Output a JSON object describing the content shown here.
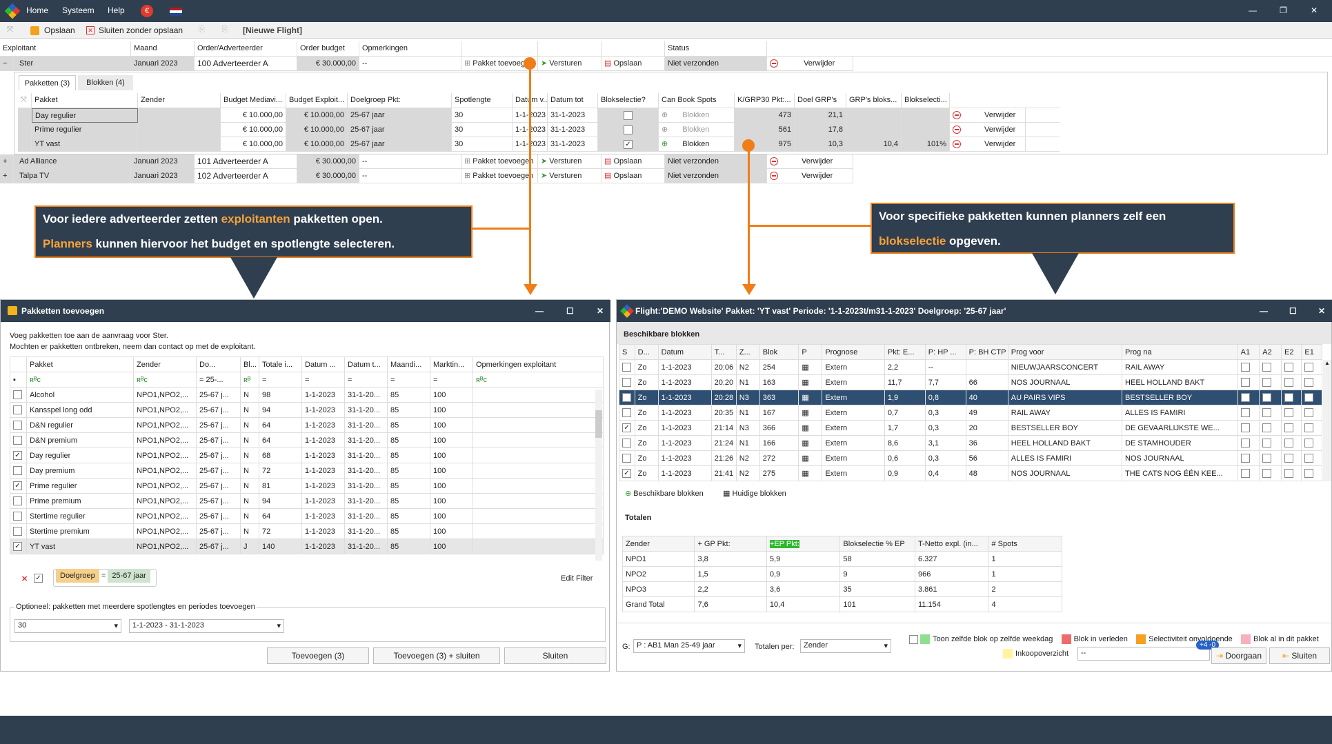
{
  "menu": {
    "home": "Home",
    "system": "Systeem",
    "help": "Help"
  },
  "toolbar": {
    "save": "Opslaan",
    "close_nosave": "Sluiten zonder opslaan",
    "new_flight": "[Nieuwe Flight]"
  },
  "orders": {
    "headers": [
      "Exploitant",
      "Maand",
      "Order/Adverteerder",
      "Order budget",
      "Opmerkingen",
      "",
      "",
      "",
      "Status"
    ],
    "rows": [
      {
        "exp": "Ster",
        "maand": "Januari 2023",
        "order": "100 Adverteerder A",
        "budget": "€ 30.000,00",
        "opm": "--",
        "add": "Pakket toevoegen",
        "send": "Versturen",
        "save": "Opslaan",
        "status": "Niet verzonden",
        "del": "Verwijder"
      },
      {
        "exp": "Ad Alliance",
        "maand": "Januari 2023",
        "order": "101 Adverteerder A",
        "budget": "€ 30.000,00",
        "opm": "--",
        "add": "Pakket toevoegen",
        "send": "Versturen",
        "save": "Opslaan",
        "status": "Niet verzonden",
        "del": "Verwijder"
      },
      {
        "exp": "Talpa TV",
        "maand": "Januari 2023",
        "order": "102 Adverteerder A",
        "budget": "€ 30.000,00",
        "opm": "--",
        "add": "Pakket toevoegen",
        "send": "Versturen",
        "save": "Opslaan",
        "status": "Niet verzonden",
        "del": "Verwijder"
      }
    ]
  },
  "subtabs": [
    "Pakketten (3)",
    "Blokken (4)"
  ],
  "pakketten": {
    "headers": [
      "Pakket",
      "Zender",
      "Budget Mediavi...",
      "Budget Exploit...",
      "Doelgroep Pkt:",
      "Spotlengte",
      "Datum v...",
      "Datum tot",
      "Blokselectie?",
      "Can Book Spots",
      "K/GRP30 Pkt:...",
      "Doel GRP's",
      "GRP's bloks...",
      "Blokselecti..."
    ],
    "rows": [
      [
        "Day regulier",
        "",
        "€ 10.000,00",
        "€ 10.000,00",
        "25-67 jaar",
        "30",
        "1-1-2023",
        "31-1-2023",
        "",
        "Blokken",
        "473",
        "21,1",
        "",
        ""
      ],
      [
        "Prime regulier",
        "",
        "€ 10.000,00",
        "€ 10.000,00",
        "25-67 jaar",
        "30",
        "1-1-2023",
        "31-1-2023",
        "",
        "Blokken",
        "561",
        "17,8",
        "",
        ""
      ],
      [
        "YT vast",
        "",
        "€ 10.000,00",
        "€ 10.000,00",
        "25-67 jaar",
        "30",
        "1-1-2023",
        "31-1-2023",
        "✓",
        "Blokken",
        "975",
        "10,3",
        "10,4",
        "101%"
      ]
    ],
    "del": "Verwijder"
  },
  "callout_left": {
    "l1a": "Voor iedere adverteerder zetten ",
    "l1b": "exploitanten",
    "l1c": " pakketten open.",
    "l2a": "Planners",
    "l2b": " kunnen hiervoor het budget en spotlengte selecteren."
  },
  "callout_right": {
    "l1": "Voor specifieke pakketten kunnen planners zelf een",
    "l2a": "blokselectie",
    "l2b": " opgeven."
  },
  "dlg1": {
    "title": "Pakketten toevoegen",
    "intro1": "Voeg pakketten toe aan de aanvraag voor Ster.",
    "intro2": "Mochten er pakketten ontbreken, neem dan contact op met de exploitant.",
    "headers": [
      "Pakket",
      "Zender",
      "Do...",
      "Bl...",
      "Totale i...",
      "Datum ...",
      "Datum t...",
      "Maandi...",
      "Marktin...",
      "Opmerkingen exploitant"
    ],
    "filter_do": "25-...",
    "rows": [
      [
        "",
        "Alcohol",
        "NPO1,NPO2,...",
        "25-67 j...",
        "N",
        "98",
        "1-1-2023",
        "31-1-20...",
        "85",
        "100"
      ],
      [
        "",
        "Kansspel long odd",
        "NPO1,NPO2,...",
        "25-67 j...",
        "N",
        "94",
        "1-1-2023",
        "31-1-20...",
        "85",
        "100"
      ],
      [
        "",
        "D&N regulier",
        "NPO1,NPO2,...",
        "25-67 j...",
        "N",
        "64",
        "1-1-2023",
        "31-1-20...",
        "85",
        "100"
      ],
      [
        "",
        "D&N premium",
        "NPO1,NPO2,...",
        "25-67 j...",
        "N",
        "64",
        "1-1-2023",
        "31-1-20...",
        "85",
        "100"
      ],
      [
        "✓",
        "Day regulier",
        "NPO1,NPO2,...",
        "25-67 j...",
        "N",
        "68",
        "1-1-2023",
        "31-1-20...",
        "85",
        "100"
      ],
      [
        "",
        "Day premium",
        "NPO1,NPO2,...",
        "25-67 j...",
        "N",
        "72",
        "1-1-2023",
        "31-1-20...",
        "85",
        "100"
      ],
      [
        "✓",
        "Prime regulier",
        "NPO1,NPO2,...",
        "25-67 j...",
        "N",
        "81",
        "1-1-2023",
        "31-1-20...",
        "85",
        "100"
      ],
      [
        "",
        "Prime premium",
        "NPO1,NPO2,...",
        "25-67 j...",
        "N",
        "94",
        "1-1-2023",
        "31-1-20...",
        "85",
        "100"
      ],
      [
        "",
        "Stertime regulier",
        "NPO1,NPO2,...",
        "25-67 j...",
        "N",
        "64",
        "1-1-2023",
        "31-1-20...",
        "85",
        "100"
      ],
      [
        "",
        "Stertime premium",
        "NPO1,NPO2,...",
        "25-67 j...",
        "N",
        "72",
        "1-1-2023",
        "31-1-20...",
        "85",
        "100"
      ],
      [
        "✓",
        "YT vast",
        "NPO1,NPO2,...",
        "25-67 j...",
        "J",
        "140",
        "1-1-2023",
        "31-1-20...",
        "85",
        "100"
      ]
    ],
    "filter_label": "Doelgroep",
    "filter_value": "25-67 jaar",
    "edit_filter": "Edit Filter",
    "optional": "Optioneel: pakketten met meerdere spotlengtes en periodes toevoegen",
    "spot": "30",
    "period": "1-1-2023 - 31-1-2023",
    "btn_add": "Toevoegen (3)",
    "btn_add_close": "Toevoegen (3) + sluiten",
    "btn_close": "Sluiten"
  },
  "dlg2": {
    "title": "Flight:'DEMO Website' Pakket: 'YT vast' Periode: '1-1-2023t/m31-1-2023' Doelgroep: '25-67 jaar'",
    "section": "Beschikbare blokken",
    "headers": [
      "S",
      "D...",
      "Datum",
      "T...",
      "Z...",
      "Blok",
      "P",
      "Prognose",
      "Pkt: E...",
      "P: HP ...",
      "P: BH CTP",
      "Prog voor",
      "Prog na",
      "A1",
      "A2",
      "E2",
      "E1"
    ],
    "rows": [
      [
        "",
        "Zo",
        "1-1-2023",
        "20:06",
        "N2",
        "254",
        "",
        "Extern",
        "2,2",
        "--",
        "",
        "NIEUWJAARSCONCERT",
        "RAIL AWAY"
      ],
      [
        "",
        "Zo",
        "1-1-2023",
        "20:20",
        "N1",
        "163",
        "",
        "Extern",
        "11,7",
        "7,7",
        "66",
        "NOS JOURNAAL",
        "HEEL HOLLAND BAKT"
      ],
      [
        "✓",
        "Zo",
        "1-1-2023",
        "20:28",
        "N3",
        "363",
        "",
        "Extern",
        "1,9",
        "0,8",
        "40",
        "AU PAIRS VIPS",
        "BESTSELLER BOY"
      ],
      [
        "",
        "Zo",
        "1-1-2023",
        "20:35",
        "N1",
        "167",
        "",
        "Extern",
        "0,7",
        "0,3",
        "49",
        "RAIL AWAY",
        "ALLES IS FAMIRI"
      ],
      [
        "✓",
        "Zo",
        "1-1-2023",
        "21:14",
        "N3",
        "366",
        "",
        "Extern",
        "1,7",
        "0,3",
        "20",
        "BESTSELLER BOY",
        "DE GEVAARLIJKSTE WE..."
      ],
      [
        "",
        "Zo",
        "1-1-2023",
        "21:24",
        "N1",
        "166",
        "",
        "Extern",
        "8,6",
        "3,1",
        "36",
        "HEEL HOLLAND BAKT",
        "DE STAMHOUDER"
      ],
      [
        "",
        "Zo",
        "1-1-2023",
        "21:26",
        "N2",
        "272",
        "",
        "Extern",
        "0,6",
        "0,3",
        "56",
        "ALLES IS FAMIRI",
        "NOS JOURNAAL"
      ],
      [
        "✓",
        "Zo",
        "1-1-2023",
        "21:41",
        "N2",
        "275",
        "",
        "Extern",
        "0,9",
        "0,4",
        "48",
        "NOS JOURNAAL",
        "THE CATS NOG ÉÉN KEE..."
      ]
    ],
    "tab1": "Beschikbare blokken",
    "tab2": "Huidige blokken",
    "totals_title": "Totalen",
    "totals_headers": [
      "Zender",
      "+ GP Pkt:",
      "+EP Pkt:",
      "Blokselectie % EP",
      "T-Netto expl. (in...",
      "# Spots"
    ],
    "totals_rows": [
      [
        "NPO1",
        "3,8",
        "5,9",
        "58",
        "6.327",
        "1"
      ],
      [
        "NPO2",
        "1,5",
        "0,9",
        "9",
        "966",
        "1"
      ],
      [
        "NPO3",
        "2,2",
        "3,6",
        "35",
        "3.861",
        "2"
      ],
      [
        "Grand Total",
        "7,6",
        "10,4",
        "101",
        "11.154",
        "4"
      ]
    ],
    "g_label": "G:",
    "g_value": "P : AB1 Man 25-49 jaar",
    "totals_per_label": "Totalen per:",
    "totals_per_value": "Zender",
    "legend": [
      "Toon zelfde blok op zelfde weekdag",
      "Blok in verleden",
      "Selectiviteit onvoldoende",
      "Blok al in dit pakket",
      "Inkoopoverzicht"
    ],
    "badge": "+4 -0",
    "btn_next": "Doorgaan",
    "btn_close": "Sluiten",
    "combo": "--"
  },
  "colors": {
    "accent": "#f07d18",
    "dark": "#2f3f50",
    "green": "#2db82d"
  }
}
